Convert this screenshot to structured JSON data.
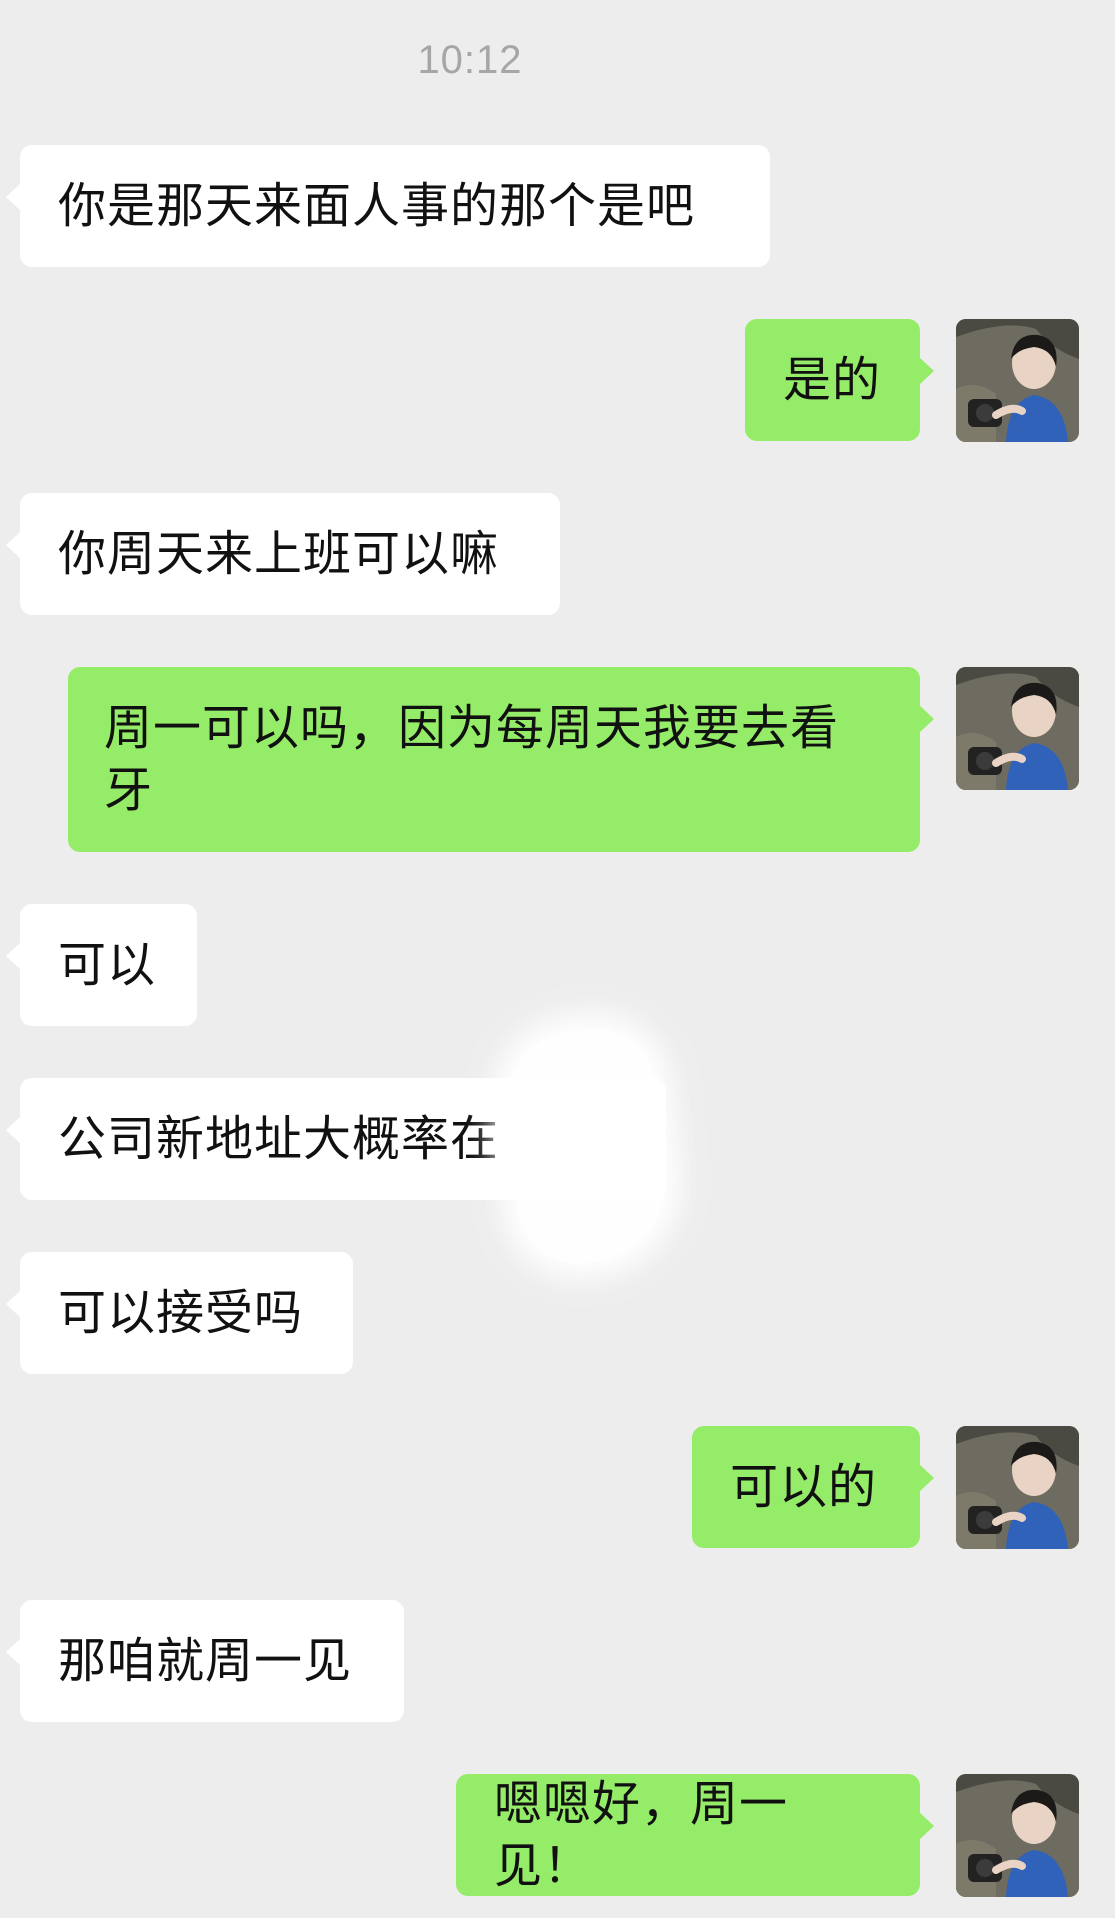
{
  "chat": {
    "timestamp": "10:12",
    "colors": {
      "background": "#ededed",
      "incoming_bubble": "#ffffff",
      "outgoing_bubble": "#95ec69",
      "timestamp_text": "#a6a6a6"
    },
    "messages": [
      {
        "direction": "incoming",
        "text": "你是那天来面人事的那个是吧"
      },
      {
        "direction": "outgoing",
        "text": "是的",
        "avatar": "user-avatar-photo"
      },
      {
        "direction": "incoming",
        "text": "你周天来上班可以嘛"
      },
      {
        "direction": "outgoing",
        "text": "周一可以吗，因为每周天我要去看牙",
        "avatar": "user-avatar-photo"
      },
      {
        "direction": "incoming",
        "text": "可以"
      },
      {
        "direction": "incoming",
        "text": "公司新地址大概率在"
      },
      {
        "direction": "incoming",
        "text": "可以接受吗"
      },
      {
        "direction": "outgoing",
        "text": "可以的",
        "avatar": "user-avatar-photo"
      },
      {
        "direction": "incoming",
        "text": "那咱就周一见"
      },
      {
        "direction": "outgoing",
        "text": "嗯嗯好，周一见！",
        "avatar": "user-avatar-photo"
      }
    ]
  }
}
